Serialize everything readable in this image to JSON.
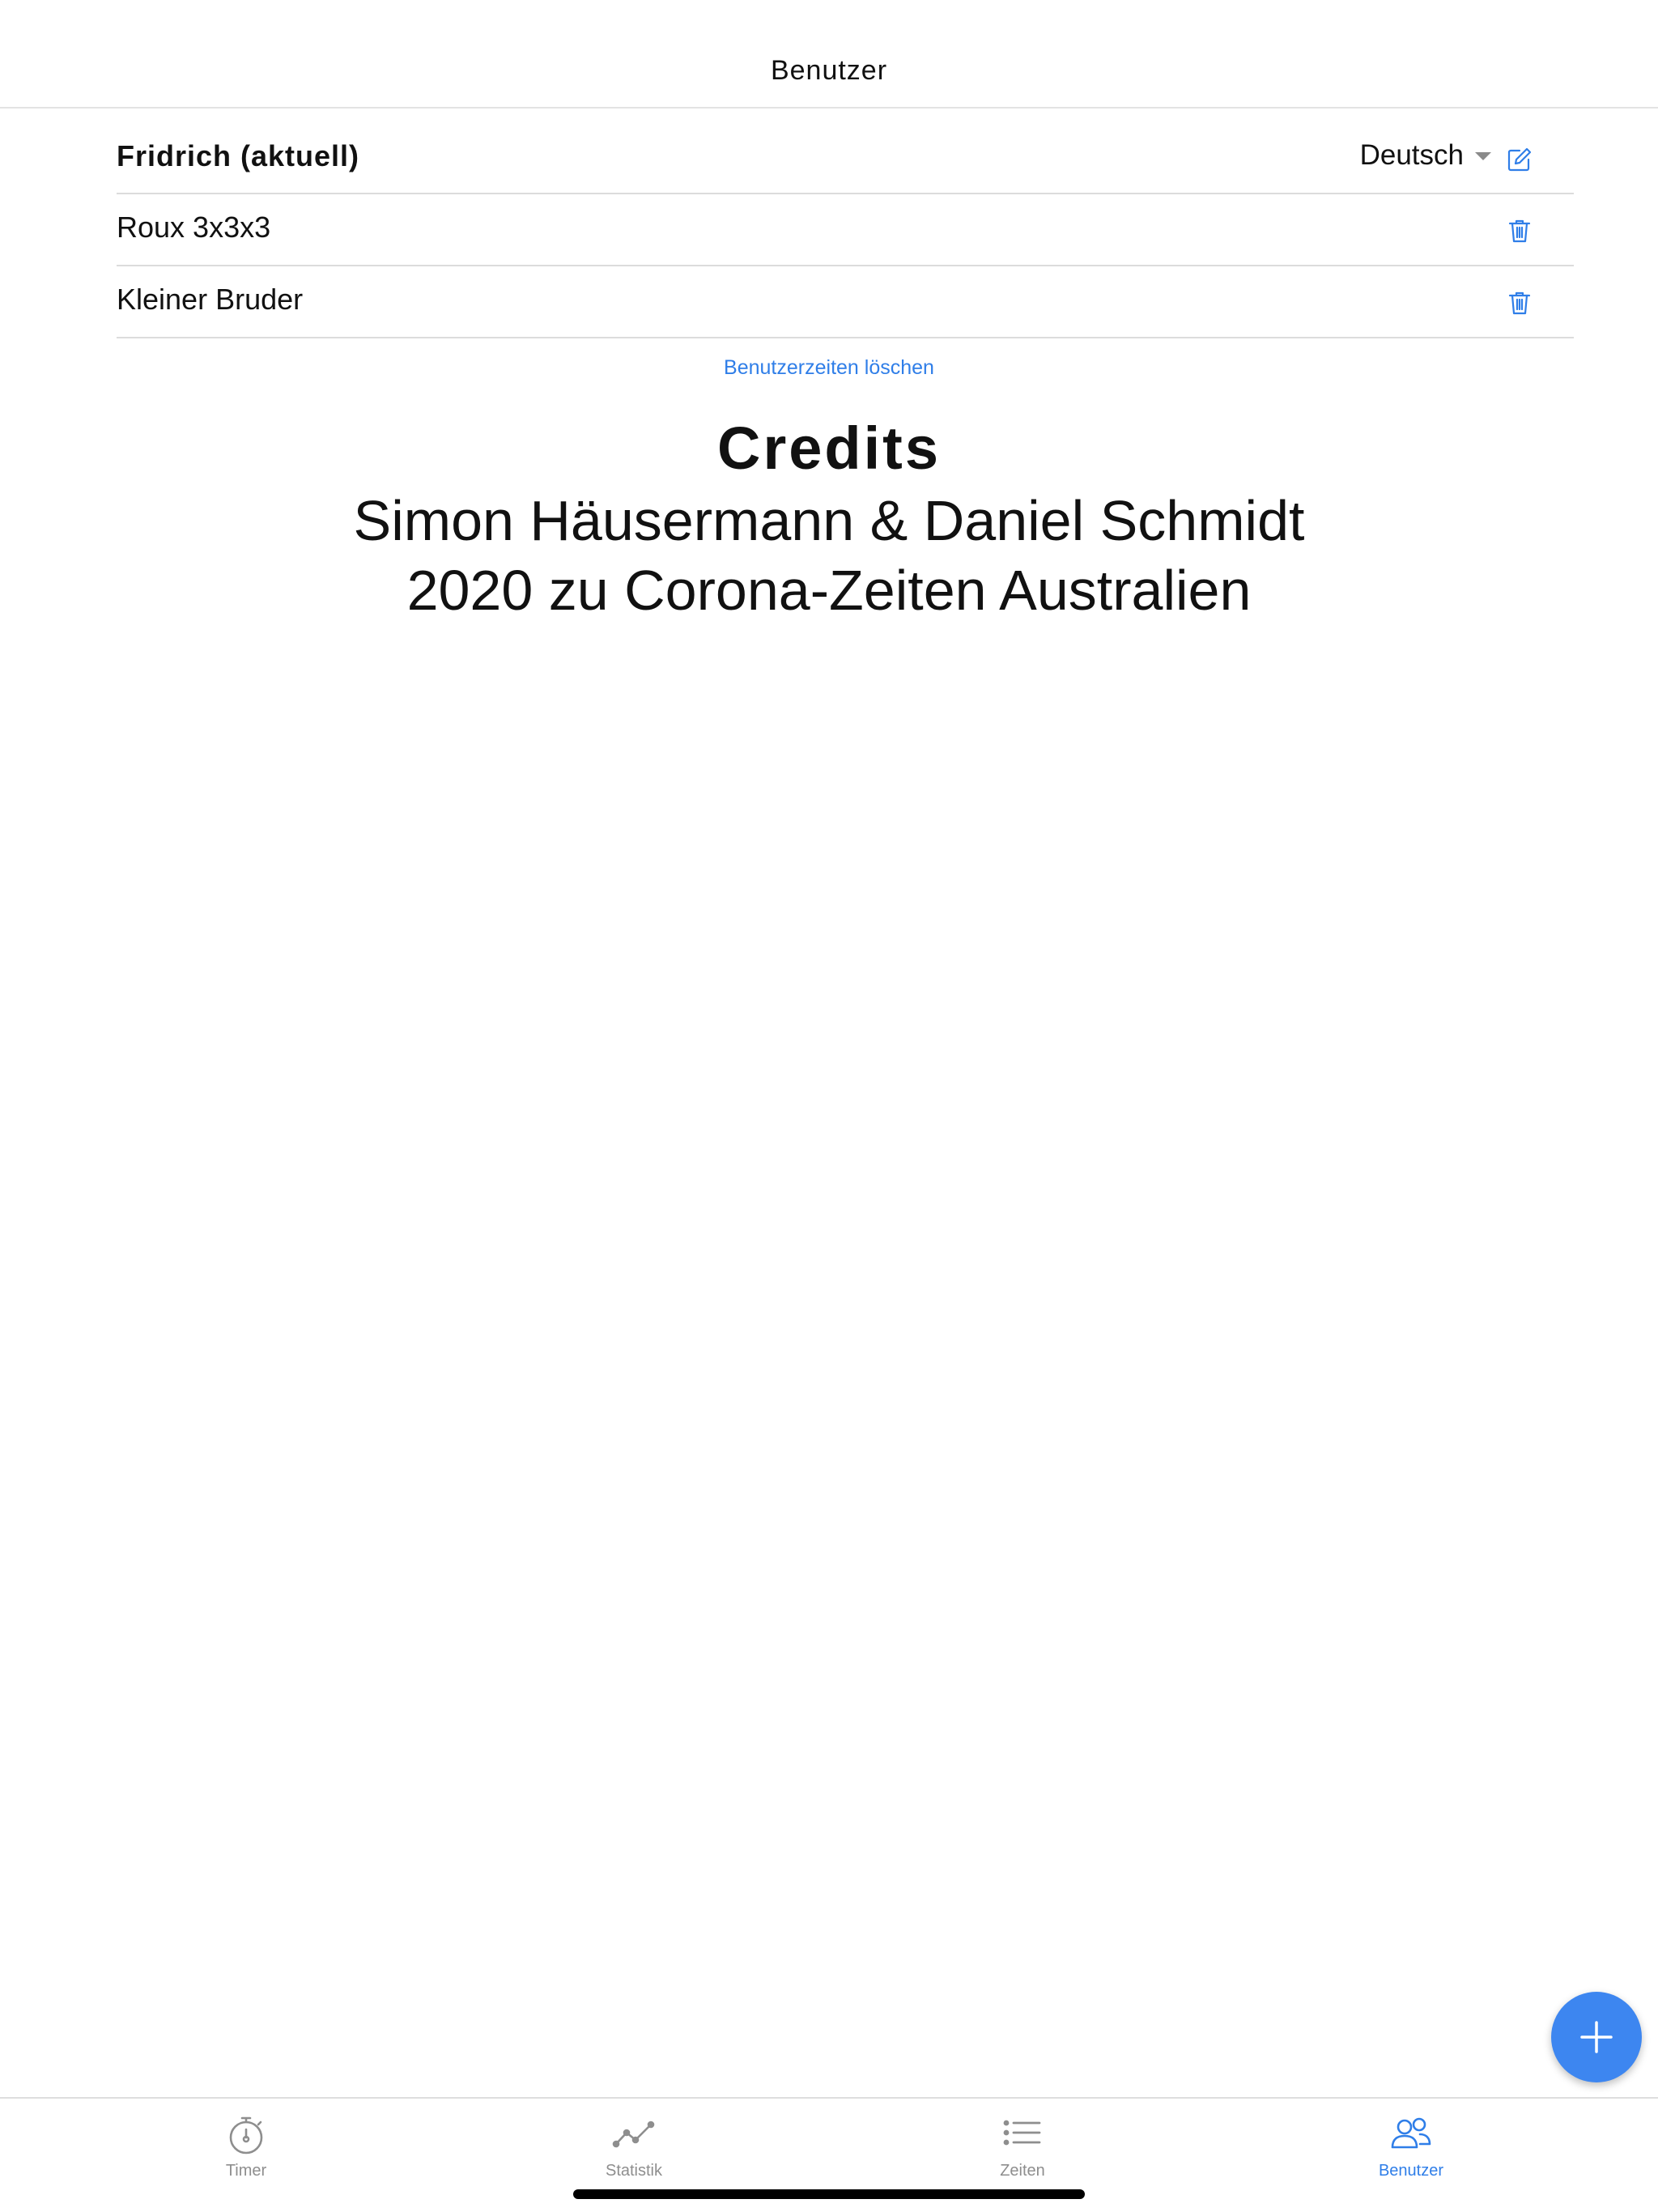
{
  "header": {
    "title": "Benutzer"
  },
  "users": [
    {
      "name": "Fridrich (aktuell)",
      "current": true
    },
    {
      "name": "Roux 3x3x3",
      "current": false
    },
    {
      "name": "Kleiner Bruder",
      "current": false
    }
  ],
  "language": {
    "selected": "Deutsch"
  },
  "delete_times_label": "Benutzerzeiten löschen",
  "credits": {
    "title": "Credits",
    "authors": "Simon Häusermann & Daniel Schmidt",
    "note": "2020 zu Corona-Zeiten Australien"
  },
  "tabs": [
    {
      "label": "Timer",
      "icon": "stopwatch-icon",
      "active": false
    },
    {
      "label": "Statistik",
      "icon": "line-chart-icon",
      "active": false
    },
    {
      "label": "Zeiten",
      "icon": "list-icon",
      "active": false
    },
    {
      "label": "Benutzer",
      "icon": "users-icon",
      "active": true
    }
  ],
  "colors": {
    "accent": "#2f7ee8",
    "fab": "#3d86f0",
    "inactive": "#8e8e8e"
  }
}
